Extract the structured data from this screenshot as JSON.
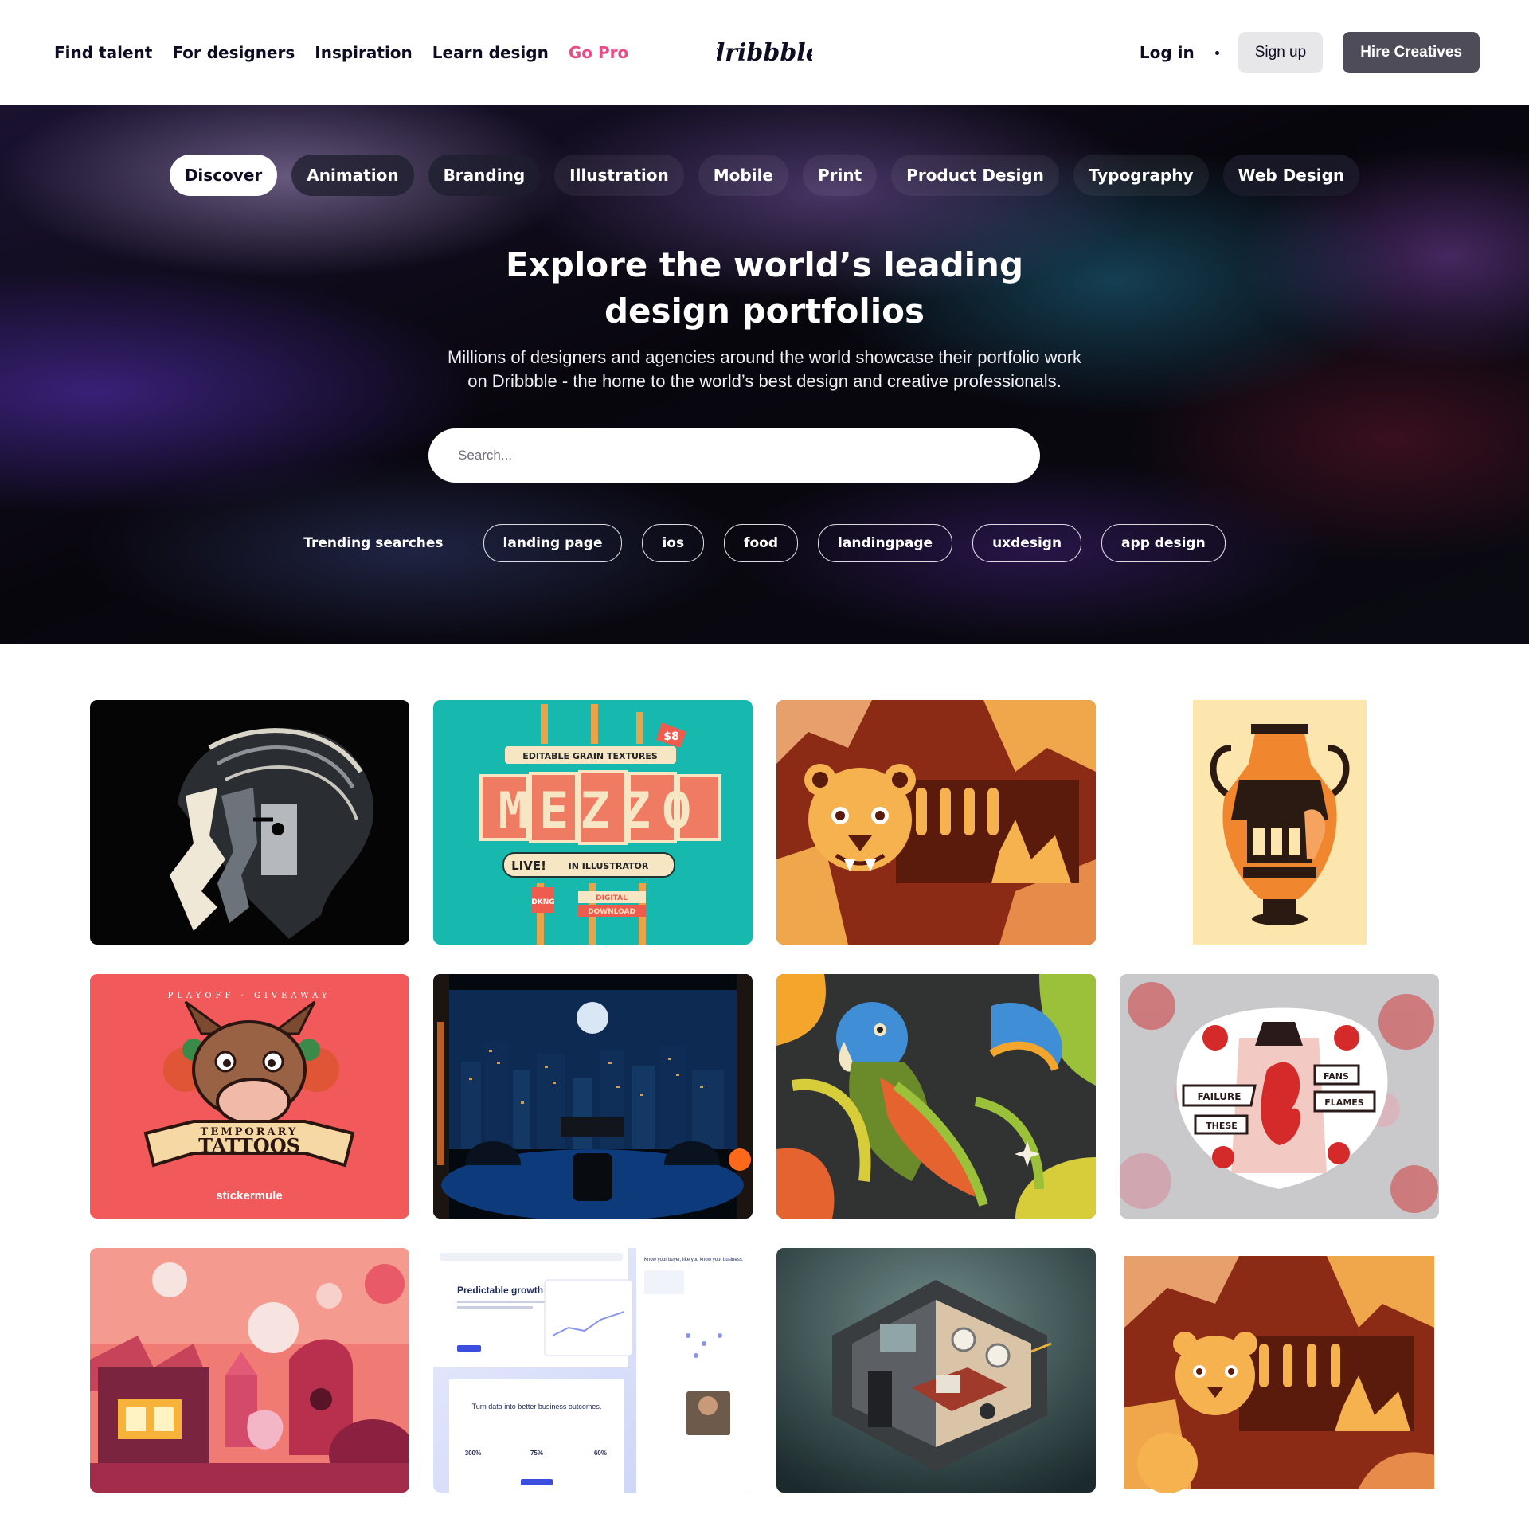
{
  "nav": {
    "items": [
      {
        "label": "Find talent"
      },
      {
        "label": "For designers"
      },
      {
        "label": "Inspiration"
      },
      {
        "label": "Learn design"
      },
      {
        "label": "Go Pro"
      }
    ],
    "logo_text": "dribbble",
    "login": "Log in",
    "signup": "Sign up",
    "hire": "Hire Creatives"
  },
  "categories": [
    "Discover",
    "Animation",
    "Branding",
    "Illustration",
    "Mobile",
    "Print",
    "Product Design",
    "Typography",
    "Web Design"
  ],
  "hero": {
    "title_line1": "Explore the world’s leading",
    "title_line2": "design portfolios",
    "subtitle_line1": "Millions of designers and agencies around the world showcase their portfolio work",
    "subtitle_line2": "on Dribbble - the home to the world’s best design and creative professionals.",
    "search_placeholder": "Search...",
    "trending_label": "Trending searches",
    "trending_tags": [
      "landing page",
      "ios",
      "food",
      "landingpage",
      "uxdesign",
      "app design"
    ]
  },
  "shots": {
    "mezzo": {
      "top": "EDITABLE GRAIN TEXTURES",
      "price": "$8",
      "title": "MEZZO",
      "live": "LIVE!",
      "in_illustrator": "IN ILLUSTRATOR",
      "brand": "DKNG",
      "digital": "DIGITAL",
      "download": "DOWNLOAD"
    },
    "tattoos": {
      "top": "PLAYOFF · GIVEAWAY",
      "line1": "TEMPORARY",
      "line2": "TATTOOS",
      "brand": "stickermule"
    },
    "sticker": {
      "w1": "FAILURE",
      "w2": "THESE",
      "w3": "FANS",
      "w4": "FLAMES"
    },
    "webui": {
      "headline": "Predictable growth starts here.",
      "sub": "Turn data into better business outcomes.",
      "card": "Know your buyer, like you know your business.",
      "stat1": "300%",
      "stat2": "75%",
      "stat3": "60%"
    }
  },
  "colors": {
    "accent": "#ea4c89",
    "hire_button": "#4f4c5a",
    "signup_button": "#e7e7e9",
    "text": "#0d0c22"
  }
}
